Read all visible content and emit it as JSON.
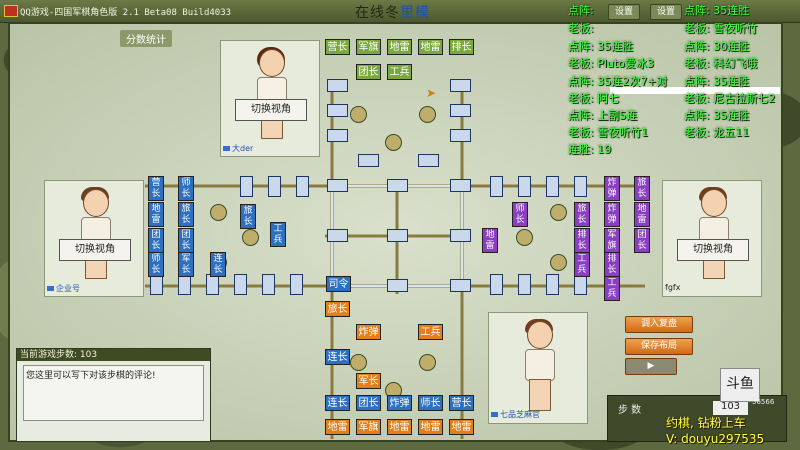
{
  "window": {
    "title": "QQ游戏-四国军棋角色版 2.1 Beta08 Build4033",
    "mode_title_part1": "在线冬",
    "mode_title_part2": "里模",
    "buttons": [
      {
        "label": "设置"
      },
      {
        "label": "设置"
      }
    ]
  },
  "panel_tab": "分数统计",
  "players": {
    "top": {
      "name": "大der",
      "view_button": "切换视角"
    },
    "left": {
      "name": "企业号",
      "view_button": "切换视角"
    },
    "right": {
      "name": "fgfx",
      "view_button": "切换视角"
    },
    "bottom": {
      "name": "七品芝麻官"
    }
  },
  "pieces": {
    "green": [
      "营长",
      "军旗",
      "地雷",
      "地雷",
      "排长",
      "团长",
      "工兵"
    ],
    "orange": [
      "旅长",
      "炸弹",
      "工兵",
      "连长",
      "军长",
      "连长",
      "团长",
      "炸弹",
      "师长",
      "旅长",
      "地雷",
      "军旗",
      "地雷",
      "地雷",
      "营长"
    ],
    "blue": [
      "司令",
      "营长",
      "连长",
      "师长",
      "地雷",
      "旅长",
      "团长",
      "团长",
      "师长",
      "军长",
      "工兵"
    ],
    "purple": [
      "炸弹",
      "旅长",
      "炸弹",
      "地雷",
      "旅长",
      "师长",
      "工兵",
      "排长",
      "地雷",
      "军旗",
      "团长"
    ]
  },
  "comment": {
    "header": "当前游戏步数: 103",
    "body": "您这里可以写下对该步棋的评论!"
  },
  "actions": {
    "load_replay": "调入复盘",
    "save_layout": "保存布局",
    "play": "▶"
  },
  "steps": {
    "label": "步 数",
    "value": "103"
  },
  "logo": {
    "text": "斗鱼",
    "id": "56566"
  },
  "stream_overlay": {
    "lines_left": [
      "点阵:",
      "老板:",
      "点阵: 35连胜",
      "老板: Pluto爱冰3",
      "点阵: 35连2次7+对",
      "老板: 阿七",
      "点阵: 上副5连",
      "老板: 雪夜听竹1",
      "连胜: 19"
    ],
    "lines_right": [
      "点阵: 35连胜",
      "老板: 雪夜听竹",
      "点阵: 30连胜",
      "老板: 科幻飞哦",
      "点阵: 35连胜",
      "老板: 尼古拉斯七2",
      "点阵: 35连胜",
      "老板: 龙五11"
    ],
    "footer1": "约棋, 钻粉上车",
    "footer2": "V: douyu297535"
  },
  "colors": {
    "green": "#7aa83c",
    "orange": "#e07f1c",
    "blue": "#2d6fc0",
    "purple": "#8a3fc0",
    "overlay": "#40ff40"
  }
}
